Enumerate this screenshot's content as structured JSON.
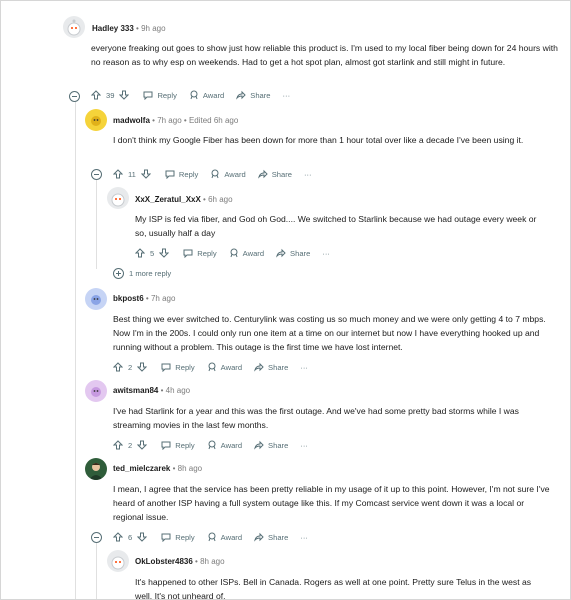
{
  "comments": [
    {
      "id": "c1",
      "author": "Hadley 333",
      "time": "9h ago",
      "edited": "",
      "text": "everyone freaking out goes to show just how reliable this product is. I'm used to my local fiber being down for 24 hours with no reason as to why esp on weekends. Had to get a hot spot plan, almost got starlink and still might in future.",
      "votes": "39"
    },
    {
      "id": "c2",
      "author": "madwolfa",
      "time": "7h ago",
      "edited": "Edited 6h ago",
      "text": "I don't think my Google Fiber has been down for more than 1 hour total over like a decade I've been using it.",
      "votes": "11"
    },
    {
      "id": "c3",
      "author": "XxX_Zeratul_XxX",
      "time": "6h ago",
      "edited": "",
      "text": "My ISP is fed via fiber, and God oh God.... We switched to Starlink because we had outage every week or so, usually half a day",
      "votes": "5"
    },
    {
      "id": "c4",
      "author": "bkpost6",
      "time": "7h ago",
      "edited": "",
      "text": "Best thing we ever switched to. Centurylink was costing us so much money and we were only getting 4 to 7 mbps. Now I'm in the 200s. I could only run one item at a time on our internet but now I have everything hooked up and running without a problem. This outage is the first time we have lost internet.",
      "votes": "2"
    },
    {
      "id": "c5",
      "author": "awitsman84",
      "time": "4h ago",
      "edited": "",
      "text": "I've had Starlink for a year and this was the first outage. And we've had some pretty bad storms while I was streaming movies in the last few months.",
      "votes": "2"
    },
    {
      "id": "c6",
      "author": "ted_mielczarek",
      "time": "8h ago",
      "edited": "",
      "text": "I mean, I agree that the service has been pretty reliable in my usage of it up to this point. However, I'm not sure I've heard of another ISP having a full system outage like this. If my Comcast service went down it was a local or regional issue.",
      "votes": "6"
    },
    {
      "id": "c7",
      "author": "OkLobster4836",
      "time": "8h ago",
      "edited": "",
      "text": "It's happened to other ISPs. Bell in Canada. Rogers as well at one point. Pretty sure Telus in the west as well. It's not unheard of.",
      "votes": ""
    }
  ],
  "labels": {
    "reply": "Reply",
    "award": "Award",
    "share": "Share",
    "more": "···",
    "separator": "•"
  },
  "more_replies": "1 more reply",
  "colors": {
    "upvote_icon": "#576f76",
    "text": "#1c1c1c",
    "meta": "#7c7c7c",
    "thread_line": "#e0e0e0"
  },
  "icons": {
    "upvote": "arrow-up-icon",
    "downvote": "arrow-down-icon",
    "reply": "speech-bubble-icon",
    "award": "award-icon",
    "share": "share-arrow-icon",
    "more": "ellipsis-icon",
    "collapse": "minus-circle-icon",
    "expand": "plus-circle-icon"
  }
}
